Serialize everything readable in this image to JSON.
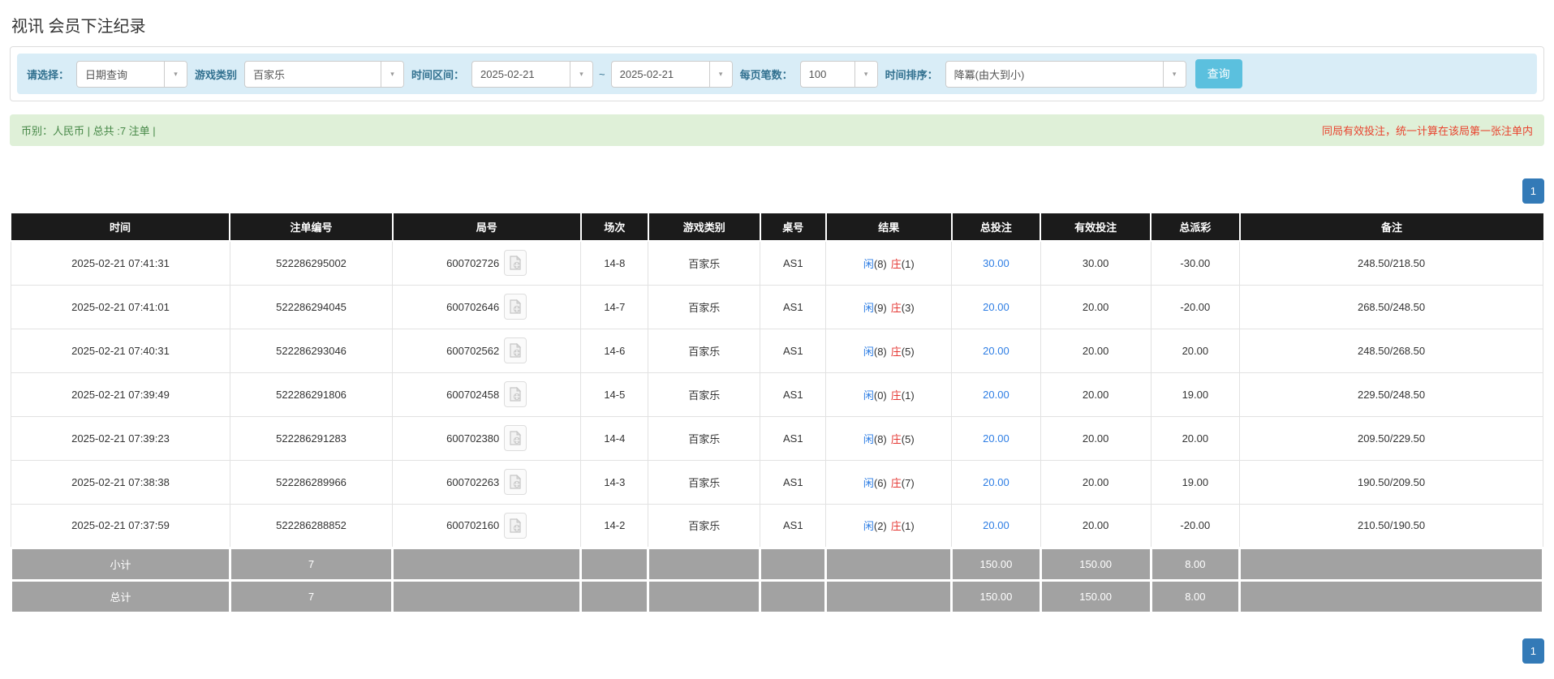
{
  "page": {
    "title": "视讯 会员下注纪录"
  },
  "filters": {
    "query_type_label": "请选择：",
    "query_type_value": "日期查询",
    "game_type_label": "游戏类别",
    "game_type_value": "百家乐",
    "date_range_label": "时间区间：",
    "date_from": "2025-02-21",
    "tilde": "~",
    "date_to": "2025-02-21",
    "page_size_label": "每页笔数：",
    "page_size_value": "100",
    "sort_label": "时间排序：",
    "sort_value": "降冪(由大到小)",
    "search_button": "查询",
    "accent_color": "#5bc0de",
    "bar_color": "#d9edf7"
  },
  "summary_bar": {
    "left_text": "币别：人民币 | 总共 :7 注单 |",
    "right_text": "同局有效投注，统一计算在该局第一张注单内",
    "left_color": "#468847",
    "right_color": "#e8432e",
    "bg_color": "#dff0d8"
  },
  "pagination": {
    "page": "1",
    "color": "#337ab7"
  },
  "table": {
    "headers": [
      "时间",
      "注单编号",
      "局号",
      "场次",
      "游戏类别",
      "桌号",
      "结果",
      "总投注",
      "有效投注",
      "总派彩",
      "备注"
    ],
    "result_colors": {
      "player": "#2d7de4",
      "banker": "#e53935"
    },
    "rows": [
      {
        "time": "2025-02-21 07:41:31",
        "bet_id": "522286295002",
        "round_id": "600702726",
        "session": "14-8",
        "game": "百家乐",
        "table_no": "AS1",
        "player_label": "闲",
        "player_pts": "(8)",
        "banker_label": "庄",
        "banker_pts": "(1)",
        "total_bet": "30.00",
        "valid_bet": "30.00",
        "payout": "-30.00",
        "remark": "248.50/218.50"
      },
      {
        "time": "2025-02-21 07:41:01",
        "bet_id": "522286294045",
        "round_id": "600702646",
        "session": "14-7",
        "game": "百家乐",
        "table_no": "AS1",
        "player_label": "闲",
        "player_pts": "(9)",
        "banker_label": "庄",
        "banker_pts": "(3)",
        "total_bet": "20.00",
        "valid_bet": "20.00",
        "payout": "-20.00",
        "remark": "268.50/248.50"
      },
      {
        "time": "2025-02-21 07:40:31",
        "bet_id": "522286293046",
        "round_id": "600702562",
        "session": "14-6",
        "game": "百家乐",
        "table_no": "AS1",
        "player_label": "闲",
        "player_pts": "(8)",
        "banker_label": "庄",
        "banker_pts": "(5)",
        "total_bet": "20.00",
        "valid_bet": "20.00",
        "payout": "20.00",
        "remark": "248.50/268.50"
      },
      {
        "time": "2025-02-21 07:39:49",
        "bet_id": "522286291806",
        "round_id": "600702458",
        "session": "14-5",
        "game": "百家乐",
        "table_no": "AS1",
        "player_label": "闲",
        "player_pts": "(0)",
        "banker_label": "庄",
        "banker_pts": "(1)",
        "total_bet": "20.00",
        "valid_bet": "20.00",
        "payout": "19.00",
        "remark": "229.50/248.50"
      },
      {
        "time": "2025-02-21 07:39:23",
        "bet_id": "522286291283",
        "round_id": "600702380",
        "session": "14-4",
        "game": "百家乐",
        "table_no": "AS1",
        "player_label": "闲",
        "player_pts": "(8)",
        "banker_label": "庄",
        "banker_pts": "(5)",
        "total_bet": "20.00",
        "valid_bet": "20.00",
        "payout": "20.00",
        "remark": "209.50/229.50"
      },
      {
        "time": "2025-02-21 07:38:38",
        "bet_id": "522286289966",
        "round_id": "600702263",
        "session": "14-3",
        "game": "百家乐",
        "table_no": "AS1",
        "player_label": "闲",
        "player_pts": "(6)",
        "banker_label": "庄",
        "banker_pts": "(7)",
        "total_bet": "20.00",
        "valid_bet": "20.00",
        "payout": "19.00",
        "remark": "190.50/209.50"
      },
      {
        "time": "2025-02-21 07:37:59",
        "bet_id": "522286288852",
        "round_id": "600702160",
        "session": "14-2",
        "game": "百家乐",
        "table_no": "AS1",
        "player_label": "闲",
        "player_pts": "(2)",
        "banker_label": "庄",
        "banker_pts": "(1)",
        "total_bet": "20.00",
        "valid_bet": "20.00",
        "payout": "-20.00",
        "remark": "210.50/190.50"
      }
    ],
    "subtotal": {
      "label": "小计",
      "count": "7",
      "total_bet": "150.00",
      "valid_bet": "150.00",
      "payout": "8.00"
    },
    "total": {
      "label": "总计",
      "count": "7",
      "total_bet": "150.00",
      "valid_bet": "150.00",
      "payout": "8.00"
    }
  }
}
